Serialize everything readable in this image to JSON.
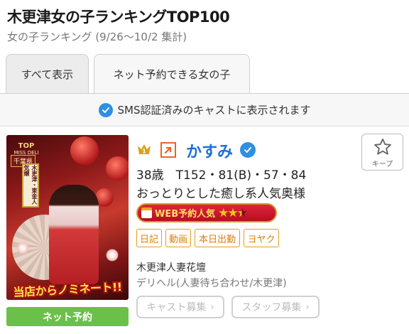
{
  "header": {
    "title": "木更津女の子ランキングTOP100",
    "subtitle": "女の子ランキング (9/26〜10/2 集計)"
  },
  "tabs": [
    {
      "label": "すべて表示",
      "active": true
    },
    {
      "label": "ネット予約できる女の子",
      "active": false
    }
  ],
  "sms_notice": {
    "text": "SMS認証済みのキャストに表示されます",
    "icon": "verified-check-icon"
  },
  "cast": {
    "rank": "1",
    "name": "かすみ",
    "stats": "38歳　T152・81(B)・57・84",
    "catchphrase": "おっとりとした癒し系人気奥様",
    "web_badge": {
      "label": "WEB予約人気",
      "stars": 2.5
    },
    "tags": [
      "日記",
      "動画",
      "本日出勤",
      "ヨヤク"
    ],
    "shop_name": "木更津人妻花壇",
    "shop_type": "デリヘル(人妻待ち合わせ/木更津)",
    "reserve_label": "ネット予約",
    "keep_label": "キープ",
    "recruit_buttons": [
      "キャスト募集",
      "スタッフ募集"
    ],
    "photo": {
      "rank_text": "TOP",
      "miss_text": "MISS DELI",
      "area_label": "千葉県",
      "sign_text": "木更津・東金人気嬢",
      "banner_text": "当店からノミネート!!"
    }
  },
  "colors": {
    "accent_blue": "#1f6fd6",
    "tag_orange": "#d8800e",
    "reserve_green": "#6cc04a",
    "badge_red": "#c01528"
  }
}
